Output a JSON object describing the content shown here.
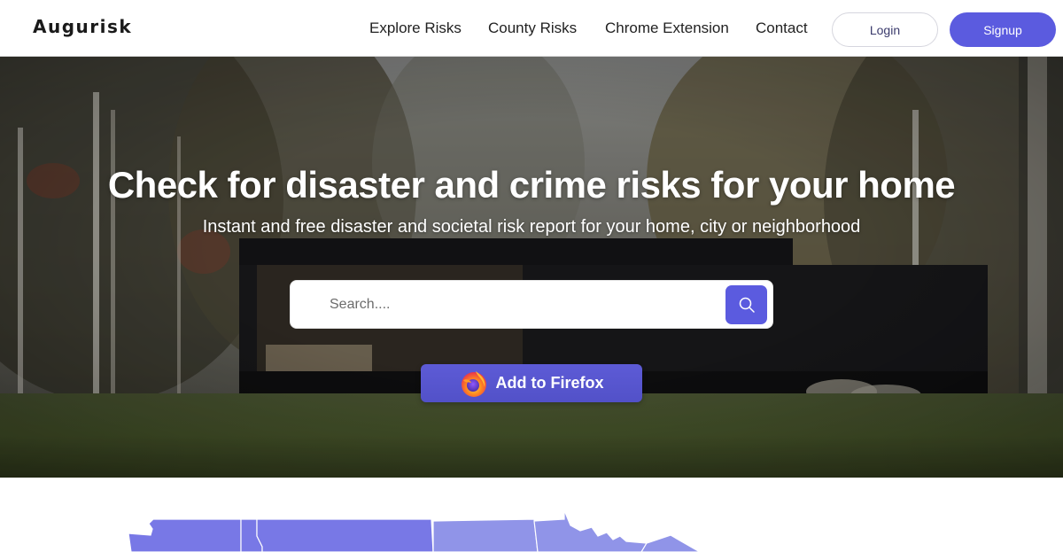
{
  "navbar": {
    "logo": "Augurisk",
    "links": [
      {
        "label": "Explore Risks"
      },
      {
        "label": "County Risks"
      },
      {
        "label": "Chrome Extension"
      },
      {
        "label": "Contact"
      }
    ],
    "login_label": "Login",
    "signup_label": "Signup"
  },
  "hero": {
    "title": "Check for disaster and crime risks for your home",
    "subtitle": "Instant and free disaster and societal risk report for your home, city or neighborhood",
    "search": {
      "placeholder": "Search....",
      "value": "",
      "button_icon": "search-icon"
    },
    "firefox_button": {
      "label": "Add to Firefox",
      "icon": "firefox-icon"
    }
  },
  "map": {
    "description": "US states choropleth map (partially visible)",
    "colors": {
      "dark": "#7878e6",
      "light": "#9094e8"
    }
  },
  "colors": {
    "accent": "#5b5bdf",
    "nav_text": "#222222",
    "login_text": "#3b3b6d"
  }
}
